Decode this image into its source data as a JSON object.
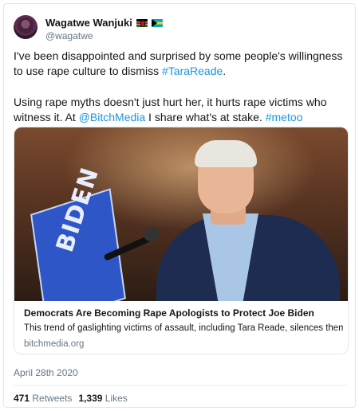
{
  "author": {
    "display_name": "Wagatwe Wanjuki",
    "handle": "@wagatwe",
    "flags": [
      "kenya-flag",
      "bahamas-flag"
    ]
  },
  "tweet": {
    "para1_text": "I've been disappointed and surprised by some people's  willingness to use rape culture to dismiss ",
    "para1_hashtag": "#TaraReade",
    "para1_end": ".",
    "para2_text": "Using rape myths doesn't just hurt her, it hurts rape victims who witness it. At ",
    "para2_mention": "@BitchMedia",
    "para2_mid": " I share what's at stake. ",
    "para2_hashtag": "#metoo"
  },
  "card": {
    "sign_text": "BIDEN",
    "title": "Democrats Are Becoming Rape Apologists to Protect Joe Biden",
    "description": "This trend of gaslighting victims of assault, including Tara Reade, silences them.",
    "domain": "bitchmedia.org"
  },
  "meta": {
    "date": "April 28th 2020",
    "retweets_count": "471",
    "retweets_label": "Retweets",
    "likes_count": "1,339",
    "likes_label": "Likes"
  },
  "colors": {
    "link": "#1b95e0",
    "secondary_text": "#657786",
    "border": "#e1e8ed"
  }
}
